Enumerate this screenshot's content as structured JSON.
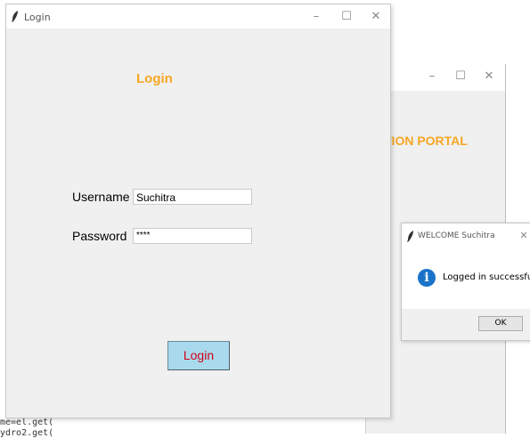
{
  "main_window": {
    "title": "Login",
    "min": "–",
    "max": "☐",
    "close": "✕",
    "heading": "Login",
    "username_label": "Username",
    "username_value": "Suchitra",
    "password_label": "Password",
    "password_value": "****",
    "login_button": "Login"
  },
  "back_window": {
    "min": "–",
    "max": "☐",
    "close": "✕",
    "title_fragment": "TION PORTAL"
  },
  "dialog": {
    "title": "WELCOME Suchitra",
    "close": "✕",
    "icon_glyph": "i",
    "message": "Logged in successfully",
    "ok": "OK"
  },
  "code": {
    "line1": "me=el.get(",
    "line2": "ydro2.get("
  },
  "colors": {
    "accent": "#f5a623",
    "login_button_bg": "#a9d9ec",
    "login_button_text": "#d0021b",
    "info_icon": "#1a73c9"
  },
  "icons": {
    "app_icon": "feather-icon",
    "info_icon": "info-icon"
  }
}
